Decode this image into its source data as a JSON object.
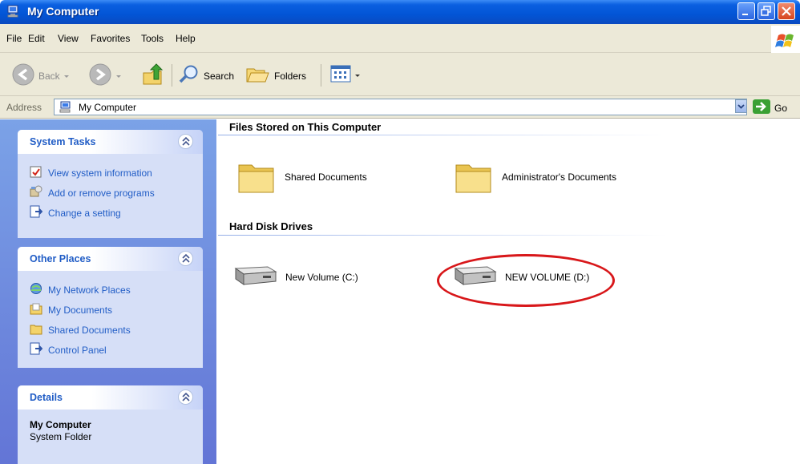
{
  "window": {
    "title": "My Computer"
  },
  "menubar": [
    "File",
    "Edit",
    "View",
    "Favorites",
    "Tools",
    "Help"
  ],
  "toolbar": {
    "back": "Back",
    "search": "Search",
    "folders": "Folders"
  },
  "address": {
    "label": "Address",
    "value": "My Computer",
    "go": "Go"
  },
  "sidebar": {
    "system_tasks": {
      "title": "System Tasks",
      "items": [
        "View system information",
        "Add or remove programs",
        "Change a setting"
      ]
    },
    "other_places": {
      "title": "Other Places",
      "items": [
        "My Network Places",
        "My Documents",
        "Shared Documents",
        "Control Panel"
      ]
    },
    "details": {
      "title": "Details",
      "name": "My Computer",
      "type": "System Folder"
    }
  },
  "content": {
    "files_group": {
      "title": "Files Stored on This Computer",
      "items": [
        "Shared Documents",
        "Administrator's Documents"
      ]
    },
    "drives_group": {
      "title": "Hard Disk Drives",
      "items": [
        "New Volume (C:)",
        "NEW VOLUME (D:)"
      ]
    }
  },
  "colors": {
    "titlebar": "#0255d6",
    "sidebar_bg": "#6f8ddf",
    "task_link": "#215dc6",
    "highlight_ellipse": "#d8171a"
  }
}
